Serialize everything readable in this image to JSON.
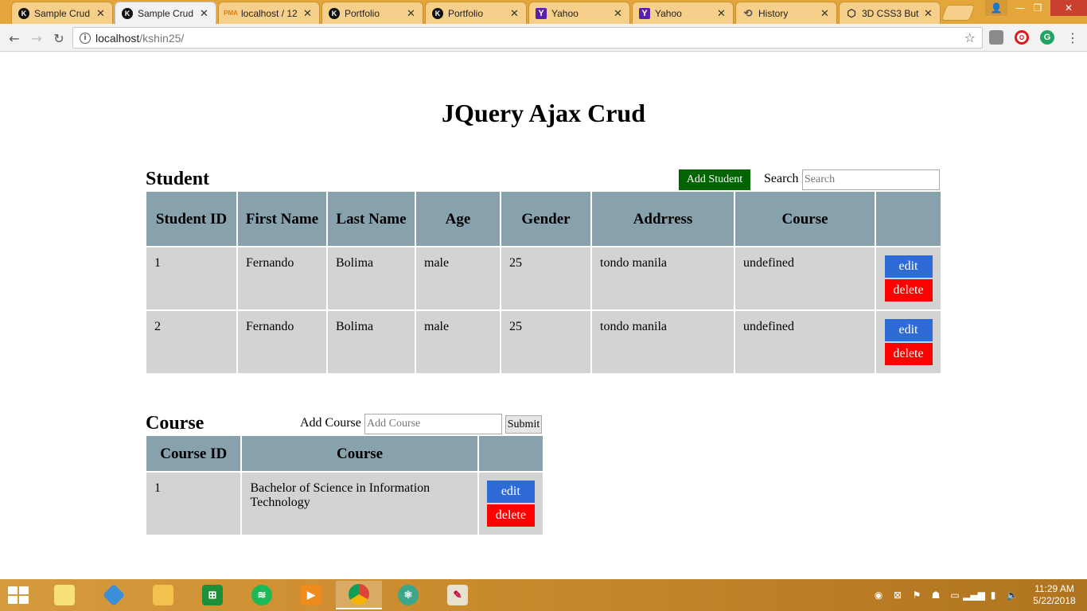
{
  "browser": {
    "tabs": [
      {
        "title": "Sample Crud",
        "favicon": "k-logo-icon"
      },
      {
        "title": "Sample Crud",
        "favicon": "k-logo-icon",
        "active": true
      },
      {
        "title": "localhost / 12",
        "favicon": "pma-icon"
      },
      {
        "title": "Portfolio",
        "favicon": "k-logo-icon"
      },
      {
        "title": "Portfolio",
        "favicon": "k-logo-icon"
      },
      {
        "title": "Yahoo",
        "favicon": "yahoo-icon"
      },
      {
        "title": "Yahoo",
        "favicon": "yahoo-icon"
      },
      {
        "title": "History",
        "favicon": "history-icon"
      },
      {
        "title": "3D CSS3 Butt",
        "favicon": "cube-icon"
      }
    ],
    "url_host": "localhost",
    "url_path": "/kshin25/",
    "extensions": {
      "opera": "O",
      "grammarly": "G"
    }
  },
  "page": {
    "title": "JQuery Ajax Crud",
    "student": {
      "heading": "Student",
      "add_button": "Add Student",
      "search_label": "Search",
      "search_placeholder": "Search",
      "columns": [
        "Student ID",
        "First Name",
        "Last Name",
        "Age",
        "Gender",
        "Addrress",
        "Course",
        ""
      ],
      "rows": [
        [
          "1",
          "Fernando",
          "Bolima",
          "male",
          "25",
          "tondo manila",
          "undefined"
        ],
        [
          "2",
          "Fernando",
          "Bolima",
          "male",
          "25",
          "tondo manila",
          "undefined"
        ]
      ],
      "edit_label": "edit",
      "delete_label": "delete"
    },
    "course": {
      "heading": "Course",
      "add_label": "Add Course",
      "add_placeholder": "Add Course",
      "submit_label": "Submit",
      "columns": [
        "Course ID",
        "Course",
        ""
      ],
      "rows": [
        [
          "1",
          "Bachelor of Science in Information Technology"
        ]
      ],
      "edit_label": "edit",
      "delete_label": "delete"
    }
  },
  "taskbar": {
    "time": "11:29 AM",
    "date": "5/22/2018"
  },
  "colors": {
    "header_bg": "#87a2ad",
    "cell_bg": "#d3d3d3",
    "add_button": "#006400",
    "edit_button": "#2e6bd6",
    "delete_button": "#ff0000",
    "tabbar": "#e4a53a"
  }
}
